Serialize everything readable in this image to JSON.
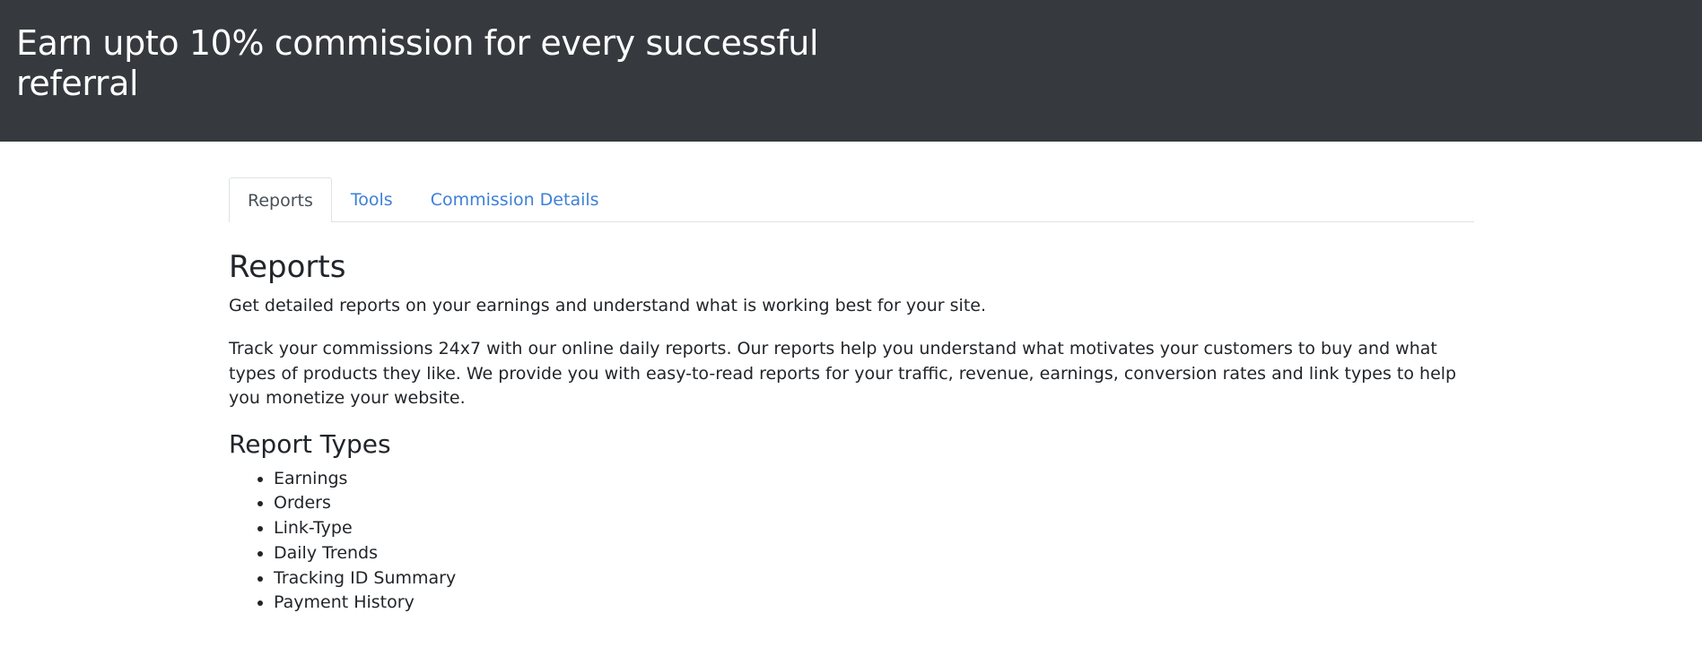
{
  "header": {
    "title": "Earn upto 10% commission for every successful referral"
  },
  "tabs": [
    {
      "label": "Reports",
      "active": true
    },
    {
      "label": "Tools",
      "active": false
    },
    {
      "label": "Commission Details",
      "active": false
    }
  ],
  "reports": {
    "title": "Reports",
    "lead": "Get detailed reports on your earnings and understand what is working best for your site.",
    "description": "Track your commissions 24x7 with our online daily reports. Our reports help you understand what motivates your customers to buy and what types of products they like. We provide you with easy-to-read reports for your traffic, revenue, earnings, conversion rates and link types to help you monetize your website.",
    "types_title": "Report Types",
    "types": [
      "Earnings",
      "Orders",
      "Link-Type",
      "Daily Trends",
      "Tracking ID Summary",
      "Payment History"
    ]
  },
  "colors": {
    "header_bg": "#363a3e",
    "tab_link": "#3d80d9",
    "text": "#212529"
  }
}
